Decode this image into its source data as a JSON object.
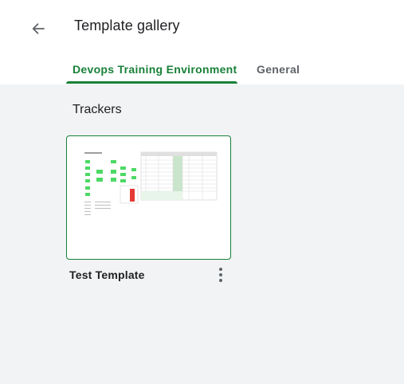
{
  "header": {
    "title": "Template gallery",
    "back_icon": "arrow-left-icon"
  },
  "tabs": [
    {
      "label": "Devops Training Environment",
      "active": true
    },
    {
      "label": "General",
      "active": false
    }
  ],
  "sections": [
    {
      "title": "Trackers",
      "templates": [
        {
          "name": "Test Template",
          "menu_icon": "more-vert-icon"
        }
      ]
    }
  ],
  "colors": {
    "accent": "#188038",
    "background": "#f1f3f4",
    "thumbnail_green": "#4cd964",
    "thumbnail_red": "#e53935"
  }
}
